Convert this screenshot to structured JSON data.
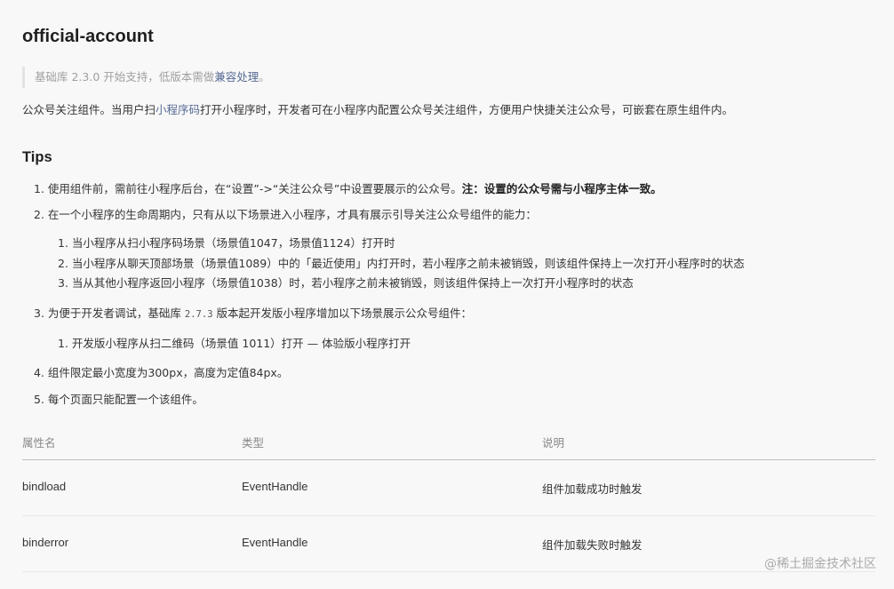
{
  "title": "official-account",
  "note": {
    "prefix": "基础库 2.3.0 开始支持，低版本需做",
    "link": "兼容处理",
    "suffix": "。"
  },
  "description": {
    "part1": "公众号关注组件。当用户扫",
    "link": "小程序码",
    "part2": "打开小程序时，开发者可在小程序内配置公众号关注组件，方便用户快捷关注公众号，可嵌套在原生组件内。"
  },
  "tips_heading": "Tips",
  "tips": {
    "item1_text": "1. 使用组件前，需前往小程序后台，在“设置”->“关注公众号”中设置要展示的公众号。",
    "item1_bold": "注：设置的公众号需与小程序主体一致。",
    "item2": "2. 在一个小程序的生命周期内，只有从以下场景进入小程序，才具有展示引导关注公众号组件的能力：",
    "item2_sub1": "1. 当小程序从扫小程序码场景（场景值1047，场景值1124）打开时",
    "item2_sub2": "2. 当小程序从聊天顶部场景（场景值1089）中的「最近使用」内打开时，若小程序之前未被销毁，则该组件保持上一次打开小程序时的状态",
    "item2_sub3": "3. 当从其他小程序返回小程序（场景值1038）时，若小程序之前未被销毁，则该组件保持上一次打开小程序时的状态",
    "item3_pre": "3. 为便于开发者调试，基础库",
    "item3_code": "2.7.3",
    "item3_post": "版本起开发版小程序增加以下场景展示公众号组件：",
    "item3_sub1": "1. 开发版小程序从扫二维码（场景值 1011）打开 — 体验版小程序打开",
    "item4": "4. 组件限定最小宽度为300px，高度为定值84px。",
    "item5": "5. 每个页面只能配置一个该组件。"
  },
  "table": {
    "headers": [
      "属性名",
      "类型",
      "说明"
    ],
    "rows": [
      [
        "bindload",
        "EventHandle",
        "组件加载成功时触发"
      ],
      [
        "binderror",
        "EventHandle",
        "组件加载失败时触发"
      ]
    ]
  },
  "watermark": "@稀土掘金技术社区"
}
